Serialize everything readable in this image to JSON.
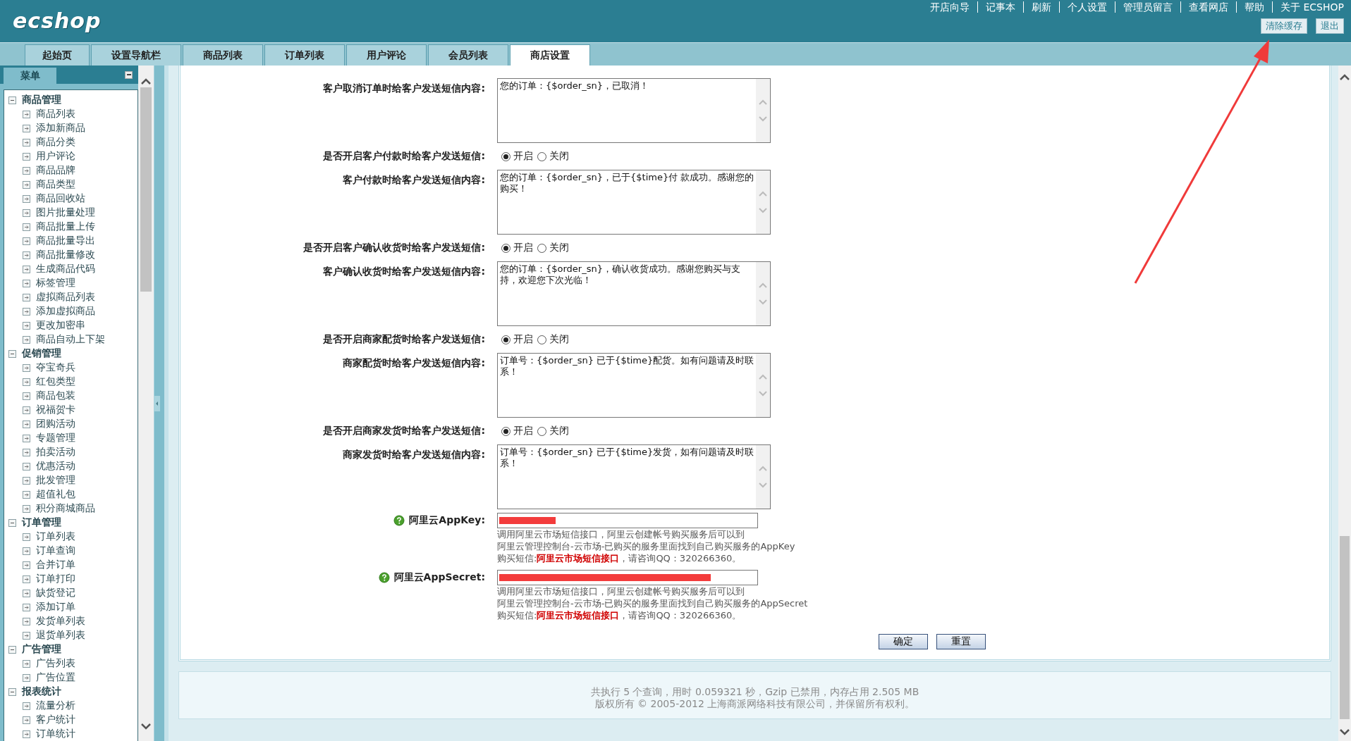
{
  "header": {
    "logo": "ecshop",
    "nav": [
      "开店向导",
      "记事本",
      "刷新",
      "个人设置",
      "管理员留言",
      "查看网店",
      "帮助",
      "关于 ECSHOP"
    ],
    "buttons": [
      "清除缓存",
      "退出"
    ]
  },
  "tabs": [
    {
      "label": "起始页",
      "selected": false
    },
    {
      "label": "设置导航栏",
      "selected": false
    },
    {
      "label": "商品列表",
      "selected": false
    },
    {
      "label": "订单列表",
      "selected": false
    },
    {
      "label": "用户评论",
      "selected": false
    },
    {
      "label": "会员列表",
      "selected": false
    },
    {
      "label": "商店设置",
      "selected": true
    }
  ],
  "sidebar": {
    "title": "菜单",
    "groups": [
      {
        "label": "商品管理",
        "expanded": true,
        "children": [
          "商品列表",
          "添加新商品",
          "商品分类",
          "用户评论",
          "商品品牌",
          "商品类型",
          "商品回收站",
          "图片批量处理",
          "商品批量上传",
          "商品批量导出",
          "商品批量修改",
          "生成商品代码",
          "标签管理",
          "虚拟商品列表",
          "添加虚拟商品",
          "更改加密串",
          "商品自动上下架"
        ]
      },
      {
        "label": "促销管理",
        "expanded": true,
        "children": [
          "夺宝奇兵",
          "红包类型",
          "商品包装",
          "祝福贺卡",
          "团购活动",
          "专题管理",
          "拍卖活动",
          "优惠活动",
          "批发管理",
          "超值礼包",
          "积分商城商品"
        ]
      },
      {
        "label": "订单管理",
        "expanded": true,
        "children": [
          "订单列表",
          "订单查询",
          "合并订单",
          "订单打印",
          "缺货登记",
          "添加订单",
          "发货单列表",
          "退货单列表"
        ]
      },
      {
        "label": "广告管理",
        "expanded": true,
        "children": [
          "广告列表",
          "广告位置"
        ]
      },
      {
        "label": "报表统计",
        "expanded": true,
        "children": [
          "流量分析",
          "客户统计",
          "订单统计"
        ]
      }
    ]
  },
  "form": {
    "rows": [
      {
        "kind": "textarea",
        "label": "客户取消订单时给客户发送短信内容:",
        "value": "您的订单：{$order_sn}，已取消！"
      },
      {
        "kind": "radio",
        "label": "是否开启客户付款时给客户发送短信:",
        "options": [
          {
            "label": "开启",
            "selected": true
          },
          {
            "label": "关闭",
            "selected": false
          }
        ]
      },
      {
        "kind": "textarea",
        "label": "客户付款时给客户发送短信内容:",
        "value": "您的订单：{$order_sn}，已于{$time}付 款成功。感谢您的购买！"
      },
      {
        "kind": "radio",
        "label": "是否开启客户确认收货时给客户发送短信:",
        "options": [
          {
            "label": "开启",
            "selected": true
          },
          {
            "label": "关闭",
            "selected": false
          }
        ]
      },
      {
        "kind": "textarea",
        "label": "客户确认收货时给客户发送短信内容:",
        "value": "您的订单：{$order_sn}，确认收货成功。感谢您购买与支持，欢迎您下次光临！"
      },
      {
        "kind": "radio",
        "label": "是否开启商家配货时给客户发送短信:",
        "options": [
          {
            "label": "开启",
            "selected": true
          },
          {
            "label": "关闭",
            "selected": false
          }
        ]
      },
      {
        "kind": "textarea",
        "label": "商家配货时给客户发送短信内容:",
        "value": "订单号：{$order_sn} 已于{$time}配货。如有问题请及时联系！"
      },
      {
        "kind": "radio",
        "label": "是否开启商家发货时给客户发送短信:",
        "options": [
          {
            "label": "开启",
            "selected": true
          },
          {
            "label": "关闭",
            "selected": false
          }
        ]
      },
      {
        "kind": "textarea",
        "label": "商家发货时给客户发送短信内容:",
        "value": "订单号：{$order_sn} 已于{$time}发货，如有问题请及时联系！"
      },
      {
        "kind": "input",
        "label": "阿里云AppKey:",
        "notes": [
          "调用阿里云市场短信接口，阿里云创建帐号购买服务后可以到",
          "阿里云管理控制台-云市场-已购买的服务里面找到自己购买服务的AppKey",
          "购买短信:**阿里云市场短信接口**，请咨询QQ：320266360。"
        ]
      },
      {
        "kind": "input",
        "label": "阿里云AppSecret:",
        "notes": [
          "调用阿里云市场短信接口，阿里云创建帐号购买服务后可以到",
          "阿里云管理控制台-云市场-已购买的服务里面找到自己购买服务的AppSecret",
          "购买短信:**阿里云市场短信接口**，请咨询QQ：320266360。"
        ]
      }
    ],
    "buttons": [
      "确定",
      "重置"
    ]
  },
  "footer": [
    "共执行 5 个查询，用时 0.059321 秒，Gzip 已禁用，内存占用 2.505 MB",
    "版权所有 © 2005-2012 上海商派网络科技有限公司，并保留所有权利。"
  ]
}
